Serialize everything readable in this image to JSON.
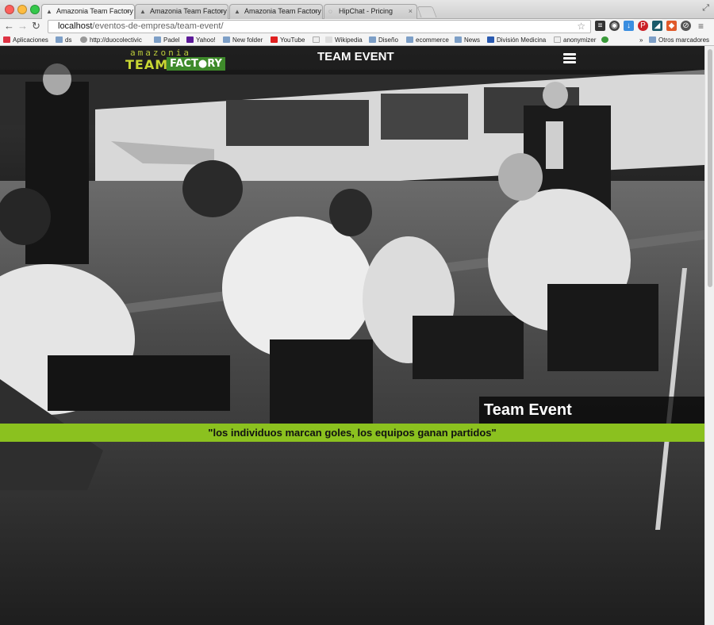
{
  "browser": {
    "tabs": [
      {
        "label": "Amazonia Team Factory Te",
        "active": true
      },
      {
        "label": "Amazonia Team Factory K",
        "active": false
      },
      {
        "label": "Amazonia Team Factory K",
        "active": false
      },
      {
        "label": "HipChat - Pricing",
        "active": false
      }
    ],
    "url_host": "localhost",
    "url_path": "/eventos-de-empresa/team-event/",
    "bookmarks": [
      "Aplicaciones",
      "ds",
      "http://duocolectivic",
      "Padel",
      "Yahoo!",
      "New folder",
      "YouTube",
      "",
      "Wikipedia",
      "Diseño",
      "ecommerce",
      "News",
      "División Medicina",
      "anonymizer",
      "",
      "»",
      "Otros marcadores"
    ]
  },
  "site": {
    "logo_top": "amazonia",
    "logo_team": "TEAM",
    "logo_factory": "FACT●RY",
    "header_title": "TEAM EVENT",
    "event_title": "Team Event",
    "quote": "\"los individuos marcan goles, los equipos ganan partidos\""
  },
  "colors": {
    "accent_green": "#8bc11f",
    "logo_green": "#3e8a2a",
    "logo_yellow": "#c8d733"
  },
  "icons": {
    "menu": "hamburger-menu-icon",
    "back": "back-arrow-icon",
    "forward": "forward-arrow-icon",
    "reload": "reload-icon",
    "star": "bookmark-star-icon"
  }
}
